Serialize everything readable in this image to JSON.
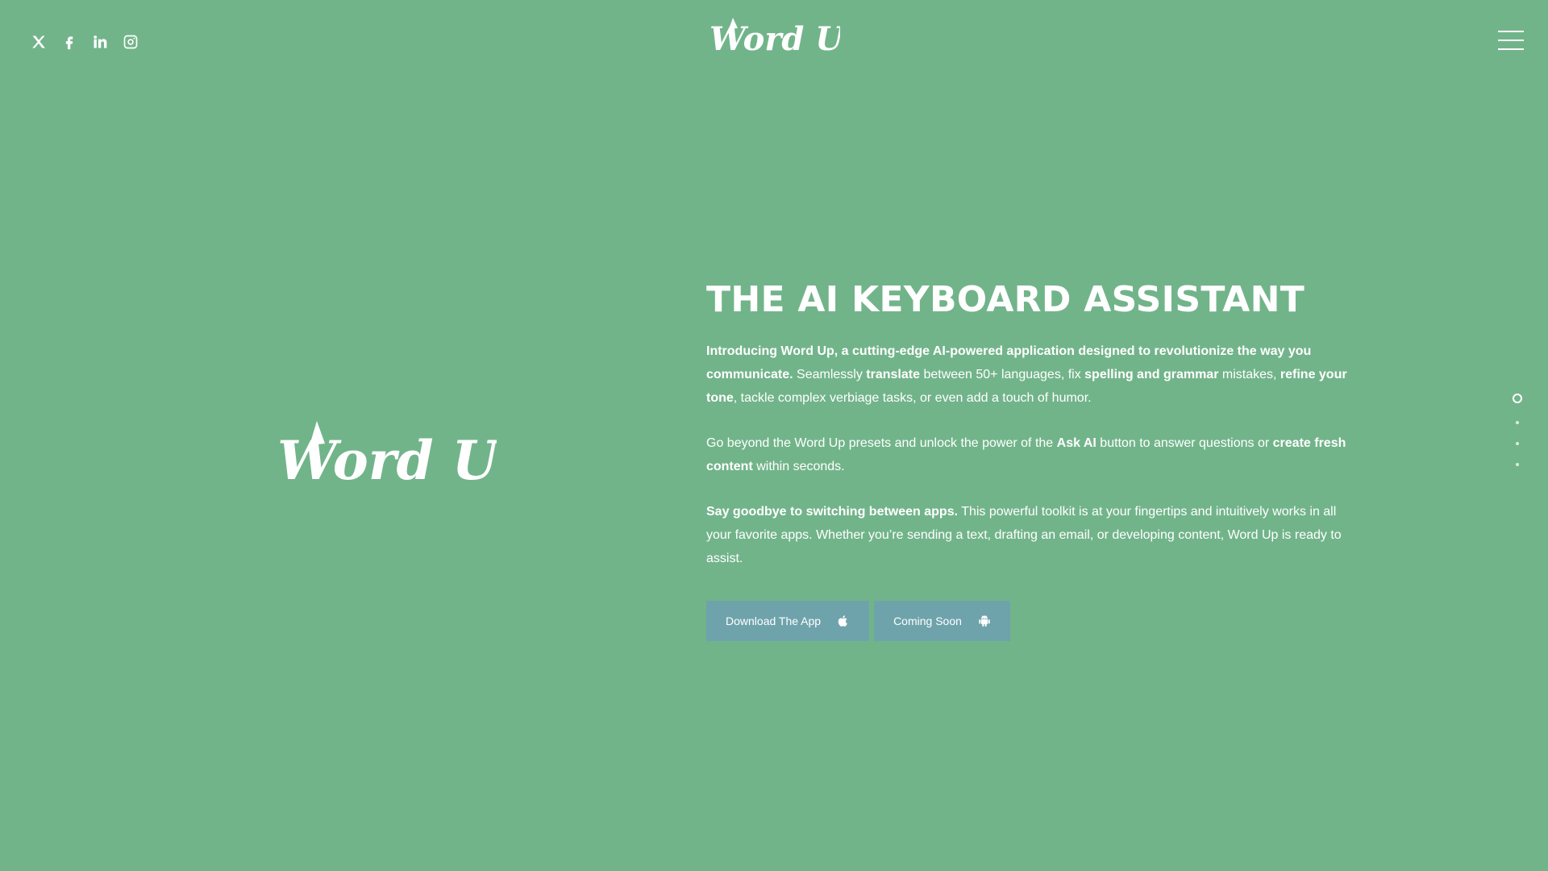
{
  "brand": {
    "logo_text": "Word Up"
  },
  "social": [
    {
      "name": "x-twitter-icon"
    },
    {
      "name": "facebook-icon"
    },
    {
      "name": "linkedin-icon"
    },
    {
      "name": "instagram-icon"
    }
  ],
  "hero": {
    "title": "THE AI KEYBOARD ASSISTANT",
    "p1": {
      "b1": "Introducing Word Up, a cutting-edge AI-powered application designed to revolutionize the way you communicate.",
      "t1": " Seamlessly ",
      "b2": "translate",
      "t2": " between 50+ languages, fix ",
      "b3": "spelling and grammar",
      "t3": " mistakes, ",
      "b4": "refine your tone",
      "t4": ", tackle complex verbiage tasks, or even add a touch of humor."
    },
    "p2": {
      "t1": "Go beyond the Word Up presets and unlock the power of the ",
      "b1": "Ask AI",
      "t2": " button to answer questions or ",
      "b2": "create fresh content",
      "t3": " within seconds."
    },
    "p3": {
      "b1": "Say goodbye to switching between apps.",
      "t1": " This powerful toolkit is at your fingertips and intuitively works in all your favorite apps. Whether you’re sending a text, drafting an email, or developing content, Word Up is ready to assist."
    },
    "buttons": {
      "download": "Download The App",
      "coming": "Coming Soon"
    }
  },
  "colors": {
    "background": "#72b48a",
    "button": "#6fa3ac",
    "text": "#ffffff"
  },
  "pagination": {
    "count": 4,
    "active_index": 0
  }
}
